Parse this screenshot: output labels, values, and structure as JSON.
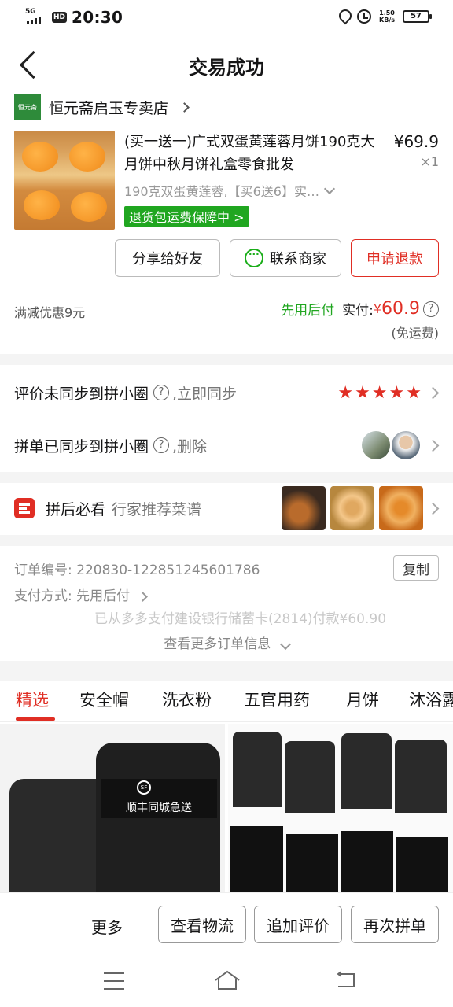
{
  "status": {
    "network": "5G",
    "hd": "HD",
    "time": "20:30",
    "speed_value": "1.50",
    "speed_unit": "KB/s",
    "battery": "57"
  },
  "header": {
    "title": "交易成功"
  },
  "store": {
    "logo_text": "恒元斋",
    "name": "恒元斋启玉专卖店"
  },
  "product": {
    "title": "(买一送一)广式双蛋黄莲蓉月饼190克大月饼中秋月饼礼盒零食批发",
    "price": "¥69.9",
    "quantity": "×1",
    "spec": "190克双蛋黄莲蓉,【买6送6】实…",
    "guarantee": "退货包运费保障中"
  },
  "actions": {
    "share": "分享给好友",
    "contact": "联系商家",
    "refund": "申请退款"
  },
  "payment": {
    "discount": "满减优惠9元",
    "pay_later": "先用后付",
    "paid_label": "实付:",
    "currency": "¥",
    "amount": "60.9",
    "help": "?",
    "shipping": "(免运费)"
  },
  "sync_rows": [
    {
      "label": "评价未同步到拼小圈",
      "help": "?",
      "action": ",立即同步",
      "stars": 5
    },
    {
      "label": "拼单已同步到拼小圈",
      "help": "?",
      "action": ",删除"
    }
  ],
  "recipe": {
    "title": "拼后必看",
    "subtitle": "行家推荐菜谱"
  },
  "order": {
    "number_label": "订单编号:",
    "number": "220830-122851245601786",
    "copy": "复制",
    "pay_method_label": "支付方式:",
    "pay_method": "先用后付",
    "pay_note": "已从多多支付建设银行储蓄卡(2814)付款¥60.90",
    "more": "查看更多订单信息"
  },
  "tabs": [
    "精选",
    "安全帽",
    "洗衣粉",
    "五官用药",
    "月饼",
    "沐浴露"
  ],
  "feed": {
    "left_brand": "顺丰同城急送",
    "left_logo": "SF"
  },
  "bottom": {
    "more": "更多",
    "logistics": "查看物流",
    "add_review": "追加评价",
    "reorder": "再次拼单"
  },
  "colors": {
    "accent": "#e02e24",
    "green": "#20a620"
  }
}
